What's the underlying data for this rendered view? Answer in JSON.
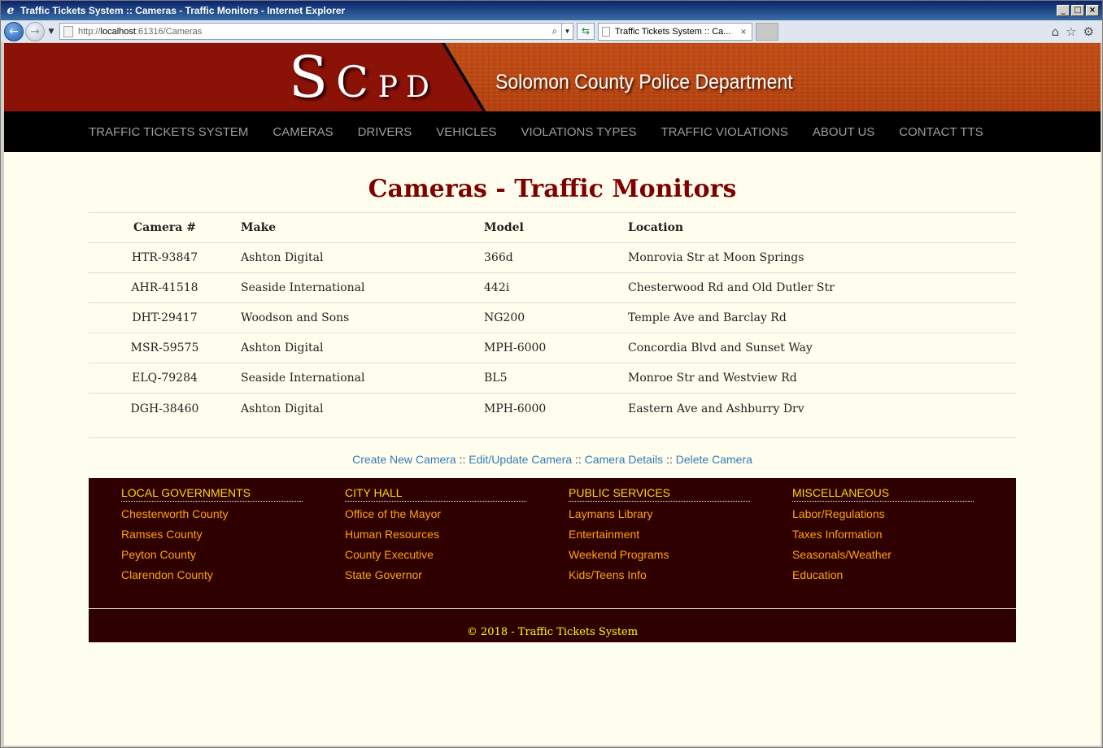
{
  "window": {
    "title": "Traffic Tickets System :: Cameras - Traffic Monitors - Internet Explorer",
    "url_prefix": "http://",
    "url_host": "localhost",
    "url_rest": ":61316/Cameras",
    "tab_title": "Traffic Tickets System :: Ca..."
  },
  "banner": {
    "logo_s": "S",
    "logo_c": "C",
    "logo_p": "P",
    "logo_d": "D",
    "department": "Solomon County Police Department"
  },
  "nav": {
    "items": [
      "TRAFFIC TICKETS SYSTEM",
      "CAMERAS",
      "DRIVERS",
      "VEHICLES",
      "VIOLATIONS TYPES",
      "TRAFFIC VIOLATIONS",
      "ABOUT US",
      "CONTACT TTS"
    ]
  },
  "main": {
    "title": "Cameras - Traffic Monitors",
    "columns": [
      "Camera #",
      "Make",
      "Model",
      "Location"
    ],
    "rows": [
      [
        "HTR-93847",
        "Ashton Digital",
        "366d",
        "Monrovia Str at Moon Springs"
      ],
      [
        "AHR-41518",
        "Seaside International",
        "442i",
        "Chesterwood Rd and Old Dutler Str"
      ],
      [
        "DHT-29417",
        "Woodson and Sons",
        "NG200",
        "Temple Ave and Barclay Rd"
      ],
      [
        "MSR-59575",
        "Ashton Digital",
        "MPH-6000",
        "Concordia Blvd and Sunset Way"
      ],
      [
        "ELQ-79284",
        "Seaside International",
        "BL5",
        "Monroe Str and Westview Rd"
      ],
      [
        "DGH-38460",
        "Ashton Digital",
        "MPH-6000",
        "Eastern Ave and Ashburry Drv"
      ]
    ],
    "actions": {
      "create": "Create New Camera",
      "edit": "Edit/Update Camera",
      "details": "Camera Details",
      "delete": "Delete Camera",
      "separator": " :: "
    }
  },
  "footer": {
    "columns": [
      {
        "heading": "LOCAL GOVERNMENTS",
        "links": [
          "Chesterworth County",
          "Ramses County",
          "Peyton County",
          "Clarendon County"
        ]
      },
      {
        "heading": "CITY HALL",
        "links": [
          "Office of the Mayor",
          "Human Resources",
          "County Executive",
          "State Governor"
        ]
      },
      {
        "heading": "PUBLIC SERVICES",
        "links": [
          "Laymans Library",
          "Entertainment",
          "Weekend Programs",
          "Kids/Teens Info"
        ]
      },
      {
        "heading": "MISCELLANEOUS",
        "links": [
          "Labor/Regulations",
          "Taxes Information",
          "Seasonals/Weather",
          "Education"
        ]
      }
    ],
    "copyright": "© 2018 - Traffic Tickets System"
  },
  "colors": {
    "heading": "#800000",
    "footer_bg": "#2f0000",
    "footer_heading": "#ffd700",
    "footer_link": "#ffa500",
    "link": "#337ab7"
  }
}
